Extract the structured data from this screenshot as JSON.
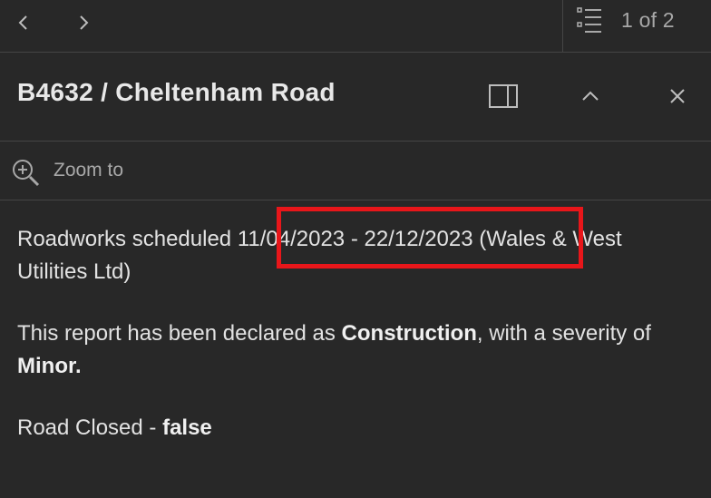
{
  "navigation": {
    "pager_text": "1 of 2",
    "icons": {
      "prev": "chevron-left-icon",
      "next": "chevron-right-icon",
      "list": "list-icon"
    }
  },
  "header": {
    "title": "B4632 / Cheltenham Road",
    "icons": {
      "dock": "dock-panel-icon",
      "collapse": "chevron-up-icon",
      "close": "close-icon"
    }
  },
  "zoom_action": {
    "label": "Zoom to",
    "icon": "zoom-in-icon"
  },
  "content": {
    "schedule_prefix": "Roadworks scheduled ",
    "schedule_dates": "11/04/2023 - 22/12/2023",
    "schedule_suffix": " (Wales & West Utilities Ltd)",
    "declared_prefix": "This report has been declared as ",
    "declared_type": "Construction",
    "declared_middle": ", with a severity of ",
    "declared_severity": "Minor.",
    "road_closed_prefix": "Road Closed - ",
    "road_closed_value": "false"
  },
  "colors": {
    "background": "#282828",
    "divider": "#454545",
    "highlight": "#e8161a"
  }
}
